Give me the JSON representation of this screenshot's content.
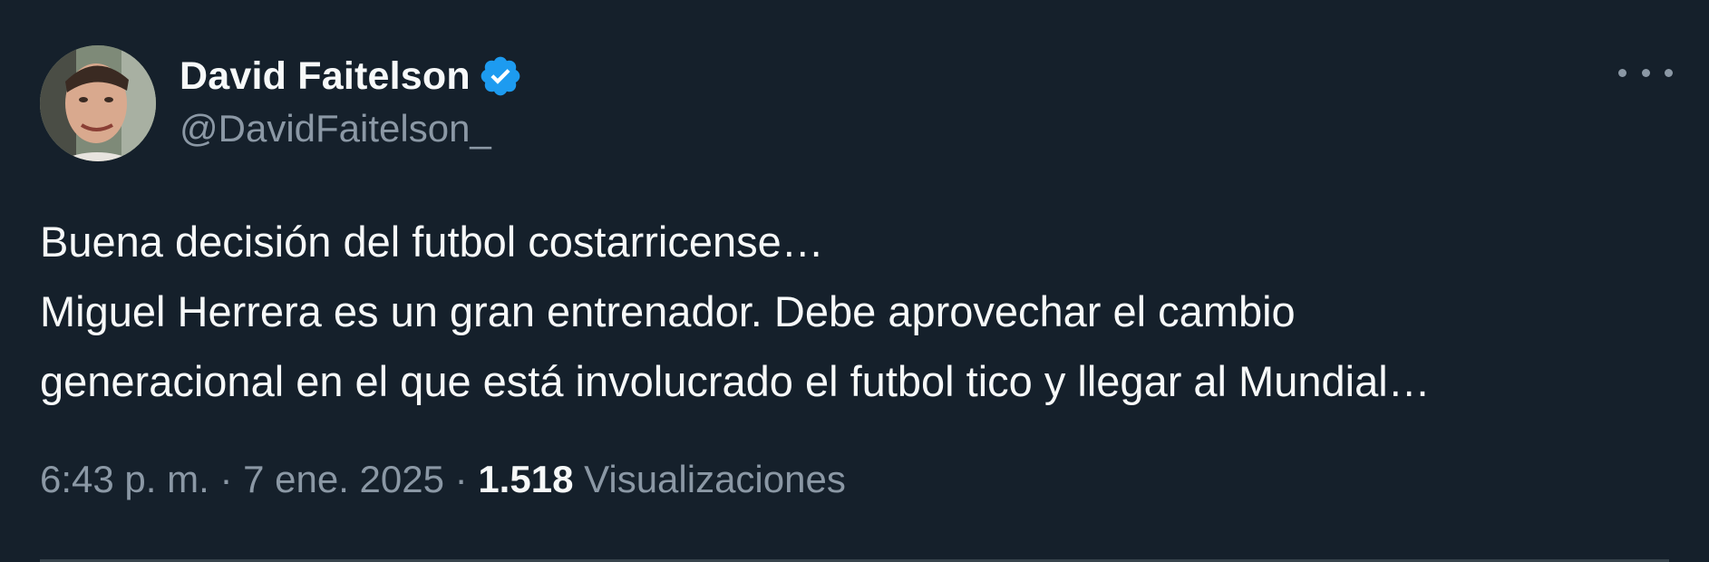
{
  "tweet": {
    "author": {
      "display_name": "David Faitelson",
      "handle": "@DavidFaitelson_",
      "verified_icon": "verified-badge-icon",
      "verified_color": "#1d9bf0"
    },
    "text_lines": [
      "Buena decisión del futbol costarricense…",
      "Miguel Herrera es un gran entrenador. Debe aprovechar el cambio",
      "generacional en el que está involucrado el futbol tico y llegar al Mundial…"
    ],
    "time": "6:43 p. m.",
    "separator": "·",
    "date": "7 ene. 2025",
    "views_count": "1.518",
    "views_label": "Visualizaciones",
    "more_icon": "more-options-icon"
  },
  "colors": {
    "background": "#15202b",
    "primary_text": "#f7f9f9",
    "secondary_text": "#8b98a5",
    "accent": "#1d9bf0"
  }
}
